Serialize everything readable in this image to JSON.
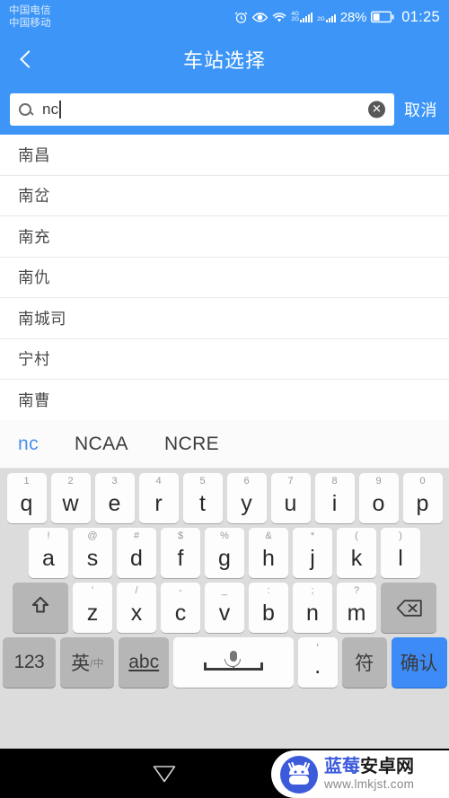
{
  "status_bar": {
    "carriers": [
      "中国电信",
      "中国移动"
    ],
    "icons": [
      "alarm-icon",
      "eye-icon",
      "wifi-icon",
      "signal-4g-icon",
      "signal-2g-icon"
    ],
    "network_labels": [
      "4G",
      "2G",
      "2G"
    ],
    "battery_percent": "28%",
    "clock": "01:25"
  },
  "header": {
    "back_icon": "chevron-left-icon",
    "title": "车站选择"
  },
  "search": {
    "icon": "search-icon",
    "value": "nc",
    "placeholder": "",
    "clear_icon": "clear-circle-icon",
    "cancel_label": "取消"
  },
  "station_list": [
    {
      "name": "南昌"
    },
    {
      "name": "南岔"
    },
    {
      "name": "南充"
    },
    {
      "name": "南仇"
    },
    {
      "name": "南城司"
    },
    {
      "name": "宁村"
    },
    {
      "name": "南曹"
    }
  ],
  "candidates": [
    {
      "text": "nc",
      "active": true
    },
    {
      "text": "NCAA",
      "active": false
    },
    {
      "text": "NCRE",
      "active": false
    }
  ],
  "keyboard": {
    "row1": [
      {
        "main": "q",
        "hint": "1"
      },
      {
        "main": "w",
        "hint": "2"
      },
      {
        "main": "e",
        "hint": "3"
      },
      {
        "main": "r",
        "hint": "4"
      },
      {
        "main": "t",
        "hint": "5"
      },
      {
        "main": "y",
        "hint": "6"
      },
      {
        "main": "u",
        "hint": "7"
      },
      {
        "main": "i",
        "hint": "8"
      },
      {
        "main": "o",
        "hint": "9"
      },
      {
        "main": "p",
        "hint": "0"
      }
    ],
    "row2": [
      {
        "main": "a",
        "hint": "!"
      },
      {
        "main": "s",
        "hint": "@"
      },
      {
        "main": "d",
        "hint": "#"
      },
      {
        "main": "f",
        "hint": "$"
      },
      {
        "main": "g",
        "hint": "%"
      },
      {
        "main": "h",
        "hint": "&"
      },
      {
        "main": "j",
        "hint": "*"
      },
      {
        "main": "k",
        "hint": "("
      },
      {
        "main": "l",
        "hint": ")"
      }
    ],
    "row3": [
      {
        "main": "z",
        "hint": "'"
      },
      {
        "main": "x",
        "hint": "/"
      },
      {
        "main": "c",
        "hint": "-"
      },
      {
        "main": "v",
        "hint": "_"
      },
      {
        "main": "b",
        "hint": ":"
      },
      {
        "main": "n",
        "hint": ";"
      },
      {
        "main": "m",
        "hint": "?"
      }
    ],
    "shift_icon": "shift-arrow-icon",
    "backspace_icon": "backspace-icon",
    "row4": {
      "numeric_label": "123",
      "lang_label": "英",
      "lang_sub": "/中",
      "abc_label": "abc",
      "space_icon": "microphone-icon",
      "dot_main": ".",
      "dot_hint": "'",
      "symbol_label": "符",
      "enter_label": "确认"
    }
  },
  "nav_bar": {
    "back_icon": "nav-back-triangle-icon",
    "home_icon": "nav-home-circle-icon"
  },
  "watermark": {
    "logo_icon": "android-robot-icon",
    "title_part1": "蓝莓",
    "title_part2": "安卓网",
    "url": "www.lmkjst.com"
  },
  "colors": {
    "accent": "#3d96f7",
    "enter_key": "#3d8bf7",
    "keyboard_bg": "#dcdcdc",
    "candidate_active": "#4a90f0",
    "watermark_blue": "#3b5bdb"
  }
}
